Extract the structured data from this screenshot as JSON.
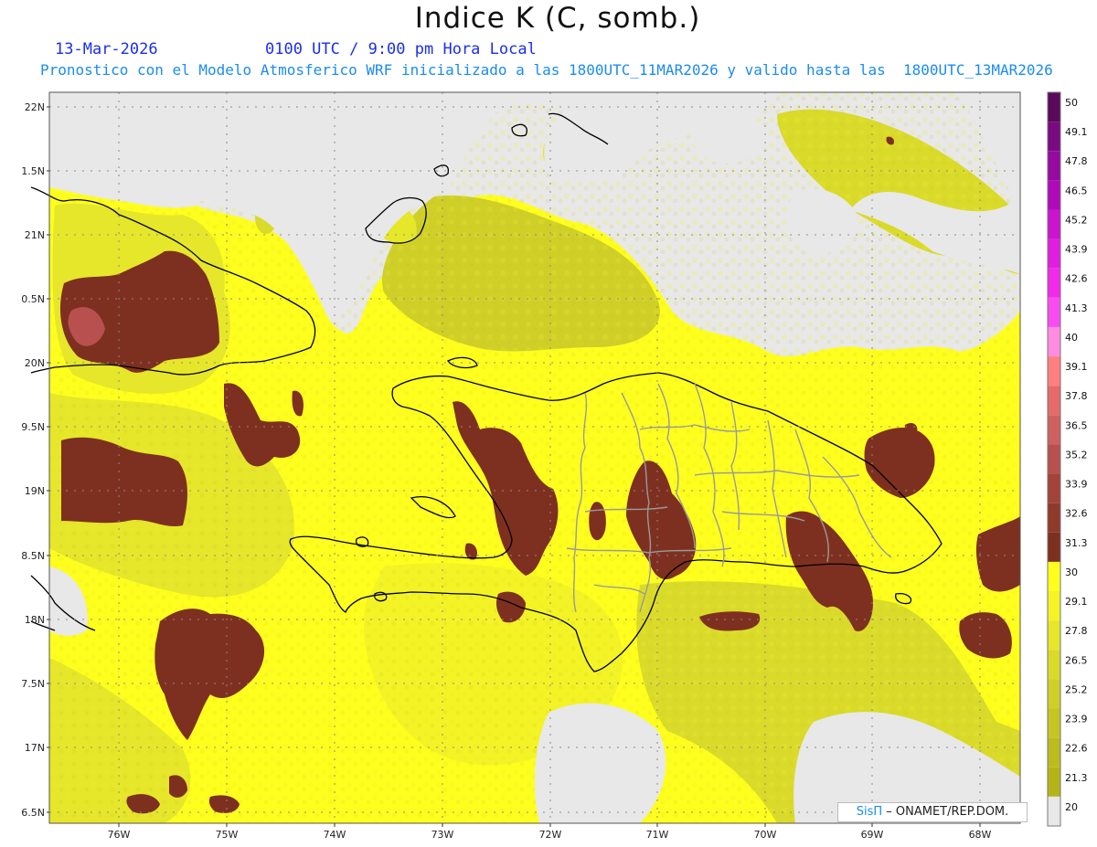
{
  "header": {
    "title": "Indice K (C, somb.)",
    "date": "13-Mar-2026",
    "time": "0100 UTC / 9:00 pm Hora Local",
    "forecast": "Pronostico con el Modelo Atmosferico WRF inicializado a las 1800UTC_11MAR2026 y valido hasta las  1800UTC_13MAR2026"
  },
  "axes": {
    "lat_labels": [
      "22N",
      "1.5N",
      "21N",
      "0.5N",
      "20N",
      "9.5N",
      "19N",
      "8.5N",
      "18N",
      "7.5N",
      "17N",
      "6.5N"
    ],
    "lon_labels": [
      "76W",
      "75W",
      "74W",
      "73W",
      "72W",
      "71W",
      "70W",
      "69W",
      "68W"
    ]
  },
  "colorbar": {
    "levels": [
      "50",
      "49.1",
      "47.8",
      "46.5",
      "45.2",
      "43.9",
      "42.6",
      "41.3",
      "40",
      "39.1",
      "37.8",
      "36.5",
      "35.2",
      "33.9",
      "32.6",
      "31.3",
      "30",
      "29.1",
      "27.8",
      "26.5",
      "25.2",
      "23.9",
      "22.6",
      "21.3",
      "20"
    ],
    "colors": [
      "#5a0a5a",
      "#7a0a82",
      "#950aa0",
      "#b00ab8",
      "#cb14cf",
      "#e01ee0",
      "#f02ae8",
      "#f84cf0",
      "#ff8ce0",
      "#ff7f7f",
      "#e66a6a",
      "#cf6060",
      "#b85050",
      "#a24438",
      "#8f3a2a",
      "#7e3020",
      "#ffff1e",
      "#f3f325",
      "#e6e62a",
      "#dada2a",
      "#cfcf28",
      "#c5c524",
      "#bcbc1e",
      "#b4b418",
      "#e8e8e8"
    ]
  },
  "credit": {
    "brand": "SisΠ",
    "text": "– ONAMET/REP.DOM."
  },
  "colors": {
    "no_data": "#e8e8e8",
    "low_k": "#d9d42e",
    "mid_k": "#ffff1e",
    "high_k": "#7e3020",
    "land_outline": "#000000",
    "province_outline": "#9a9a9a"
  }
}
